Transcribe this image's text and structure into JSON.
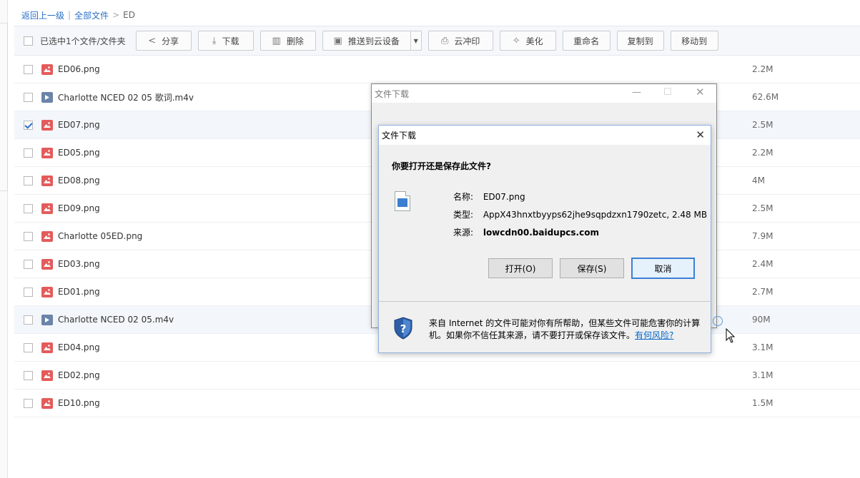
{
  "breadcrumb": {
    "back": "返回上一级",
    "all": "全部文件",
    "separator": ">",
    "current": "ED"
  },
  "toolbar": {
    "selected_text": "已选中1个文件/文件夹",
    "share": "分享",
    "download": "下载",
    "delete": "删除",
    "push": "推送到云设备",
    "print": "云冲印",
    "beautify": "美化",
    "rename": "重命名",
    "copy": "复制到",
    "move": "移动到"
  },
  "files": [
    {
      "name": "ED06.png",
      "size": "2.2M",
      "type": "image",
      "checked": false
    },
    {
      "name": "Charlotte NCED 02 05 歌词.m4v",
      "size": "62.6M",
      "type": "video",
      "checked": false
    },
    {
      "name": "ED07.png",
      "size": "2.5M",
      "type": "image",
      "checked": true
    },
    {
      "name": "ED05.png",
      "size": "2.2M",
      "type": "image",
      "checked": false
    },
    {
      "name": "ED08.png",
      "size": "4M",
      "type": "image",
      "checked": false
    },
    {
      "name": "ED09.png",
      "size": "2.5M",
      "type": "image",
      "checked": false
    },
    {
      "name": "Charlotte 05ED.png",
      "size": "7.9M",
      "type": "image",
      "checked": false
    },
    {
      "name": "ED03.png",
      "size": "2.4M",
      "type": "image",
      "checked": false
    },
    {
      "name": "ED01.png",
      "size": "2.7M",
      "type": "image",
      "checked": false
    },
    {
      "name": "Charlotte NCED 02 05.m4v",
      "size": "90M",
      "type": "video",
      "checked": false
    },
    {
      "name": "ED04.png",
      "size": "3.1M",
      "type": "image",
      "checked": false
    },
    {
      "name": "ED02.png",
      "size": "3.1M",
      "type": "image",
      "checked": false
    },
    {
      "name": "ED10.png",
      "size": "1.5M",
      "type": "image",
      "checked": false
    }
  ],
  "outer_dialog": {
    "title": "文件下载"
  },
  "dialog": {
    "title": "文件下载",
    "question": "你要打开还是保存此文件?",
    "name_label": "名称:",
    "name_value": "ED07.png",
    "type_label": "类型:",
    "type_value": "AppX43hnxtbyyps62jhe9sqpdzxn1790zetc, 2.48 MB",
    "source_label": "来源:",
    "source_value": "lowcdn00.baidupcs.com",
    "open_btn": "打开(O)",
    "save_btn": "保存(S)",
    "cancel_btn": "取消",
    "warning": "来自 Internet 的文件可能对你有所帮助，但某些文件可能危害你的计算机。如果你不信任其来源，请不要打开或保存该文件。",
    "risk_link": "有何风险?"
  },
  "colors": {
    "link": "#2a6fc9",
    "image_icon": "#e45b5b",
    "video_icon": "#6b84a8",
    "primary_border": "#3c7fd6"
  }
}
